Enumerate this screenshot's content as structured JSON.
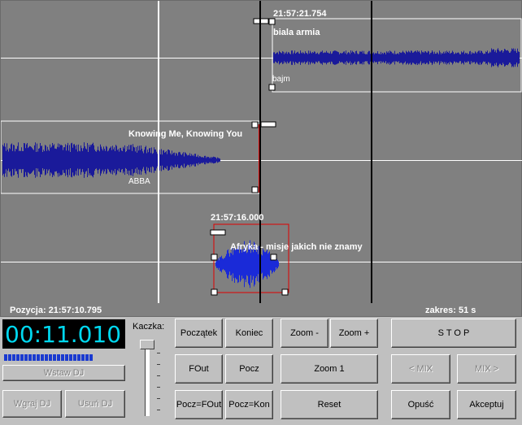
{
  "tracks": [
    {
      "time": "21:57:21.754",
      "title": "biala armia",
      "artist": "bajm"
    },
    {
      "title": "Knowing Me, Knowing You",
      "artist": "ABBA"
    },
    {
      "time": "21:57:16.000",
      "title": "Afryka - misje jakich nie znamy"
    }
  ],
  "status": {
    "position": "Pozycja: 21:57:10.795",
    "range": "zakres: 51 s"
  },
  "display": {
    "time": "00:11.010"
  },
  "duck": {
    "label": "Kaczka:"
  },
  "buttons": {
    "insert_dj": "Wstaw DJ",
    "load_dj": "Wgraj DJ",
    "remove_dj": "Usuń DJ",
    "start": "Początek",
    "end": "Koniec",
    "fout": "FOut",
    "pocz": "Pocz",
    "pocz_fout": "Pocz=FOut",
    "pocz_kon": "Pocz=Kon",
    "zoom_out": "Zoom -",
    "zoom_in": "Zoom +",
    "zoom1": "Zoom 1",
    "reset": "Reset",
    "stop": "S T O P",
    "mix_prev": "< MIX",
    "mix_next": "MIX >",
    "skip": "Opuść",
    "accept": "Akceptuj"
  },
  "colors": {
    "waveform": "#1a1a9a",
    "selected_waveform": "#1a2ad8",
    "display_text": "#00d8f0",
    "cue_green": "#00e000",
    "cue_red": "#e00000"
  }
}
